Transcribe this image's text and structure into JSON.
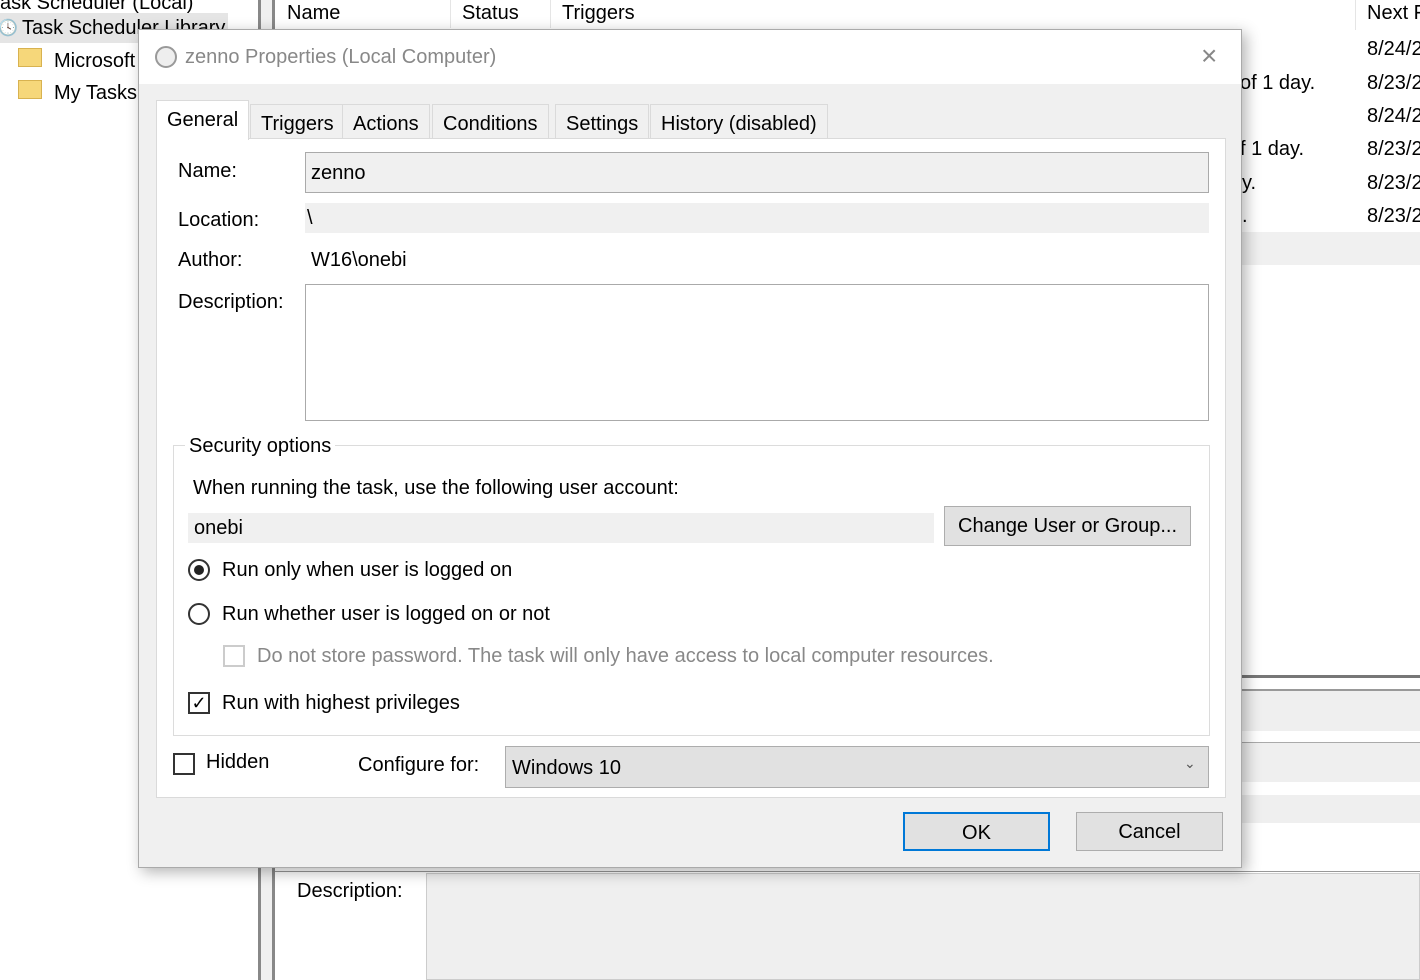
{
  "tree": {
    "root": "Task Scheduler (Local)",
    "library": "Task Scheduler Library",
    "items": [
      "Microsoft",
      "My Tasks"
    ]
  },
  "list": {
    "columns": [
      "Name",
      "Status",
      "Triggers",
      "Next Run Time"
    ],
    "column_visible": [
      "Name",
      "Status",
      "Triggers",
      "Next F"
    ],
    "trigger_fragments": [
      "of 1 day.",
      "f 1 day.",
      "y.",
      "."
    ],
    "next_run": [
      "8/24/2",
      "8/23/2",
      "8/24/2",
      "8/23/2",
      "8/23/2",
      "8/23/2"
    ]
  },
  "lower": {
    "description_label": "Description:"
  },
  "dialog": {
    "title": "zenno Properties (Local Computer)",
    "tabs": [
      "General",
      "Triggers",
      "Actions",
      "Conditions",
      "Settings",
      "History (disabled)"
    ],
    "name_label": "Name:",
    "name_value": "zenno",
    "location_label": "Location:",
    "location_value": "\\",
    "author_label": "Author:",
    "author_value": "W16\\onebi",
    "description_label": "Description:",
    "description_value": "",
    "security": {
      "legend": "Security options",
      "prompt": "When running the task, use the following user account:",
      "account": "onebi",
      "change_button": "Change User or Group...",
      "radio_logged_on": "Run only when user is logged on",
      "radio_whether": "Run whether user is logged on or not",
      "no_store": "Do not store password.  The task will only have access to local computer resources.",
      "highest": "Run with highest privileges"
    },
    "hidden_label": "Hidden",
    "configure_label": "Configure for:",
    "configure_value": "Windows 10",
    "ok": "OK",
    "cancel": "Cancel"
  }
}
